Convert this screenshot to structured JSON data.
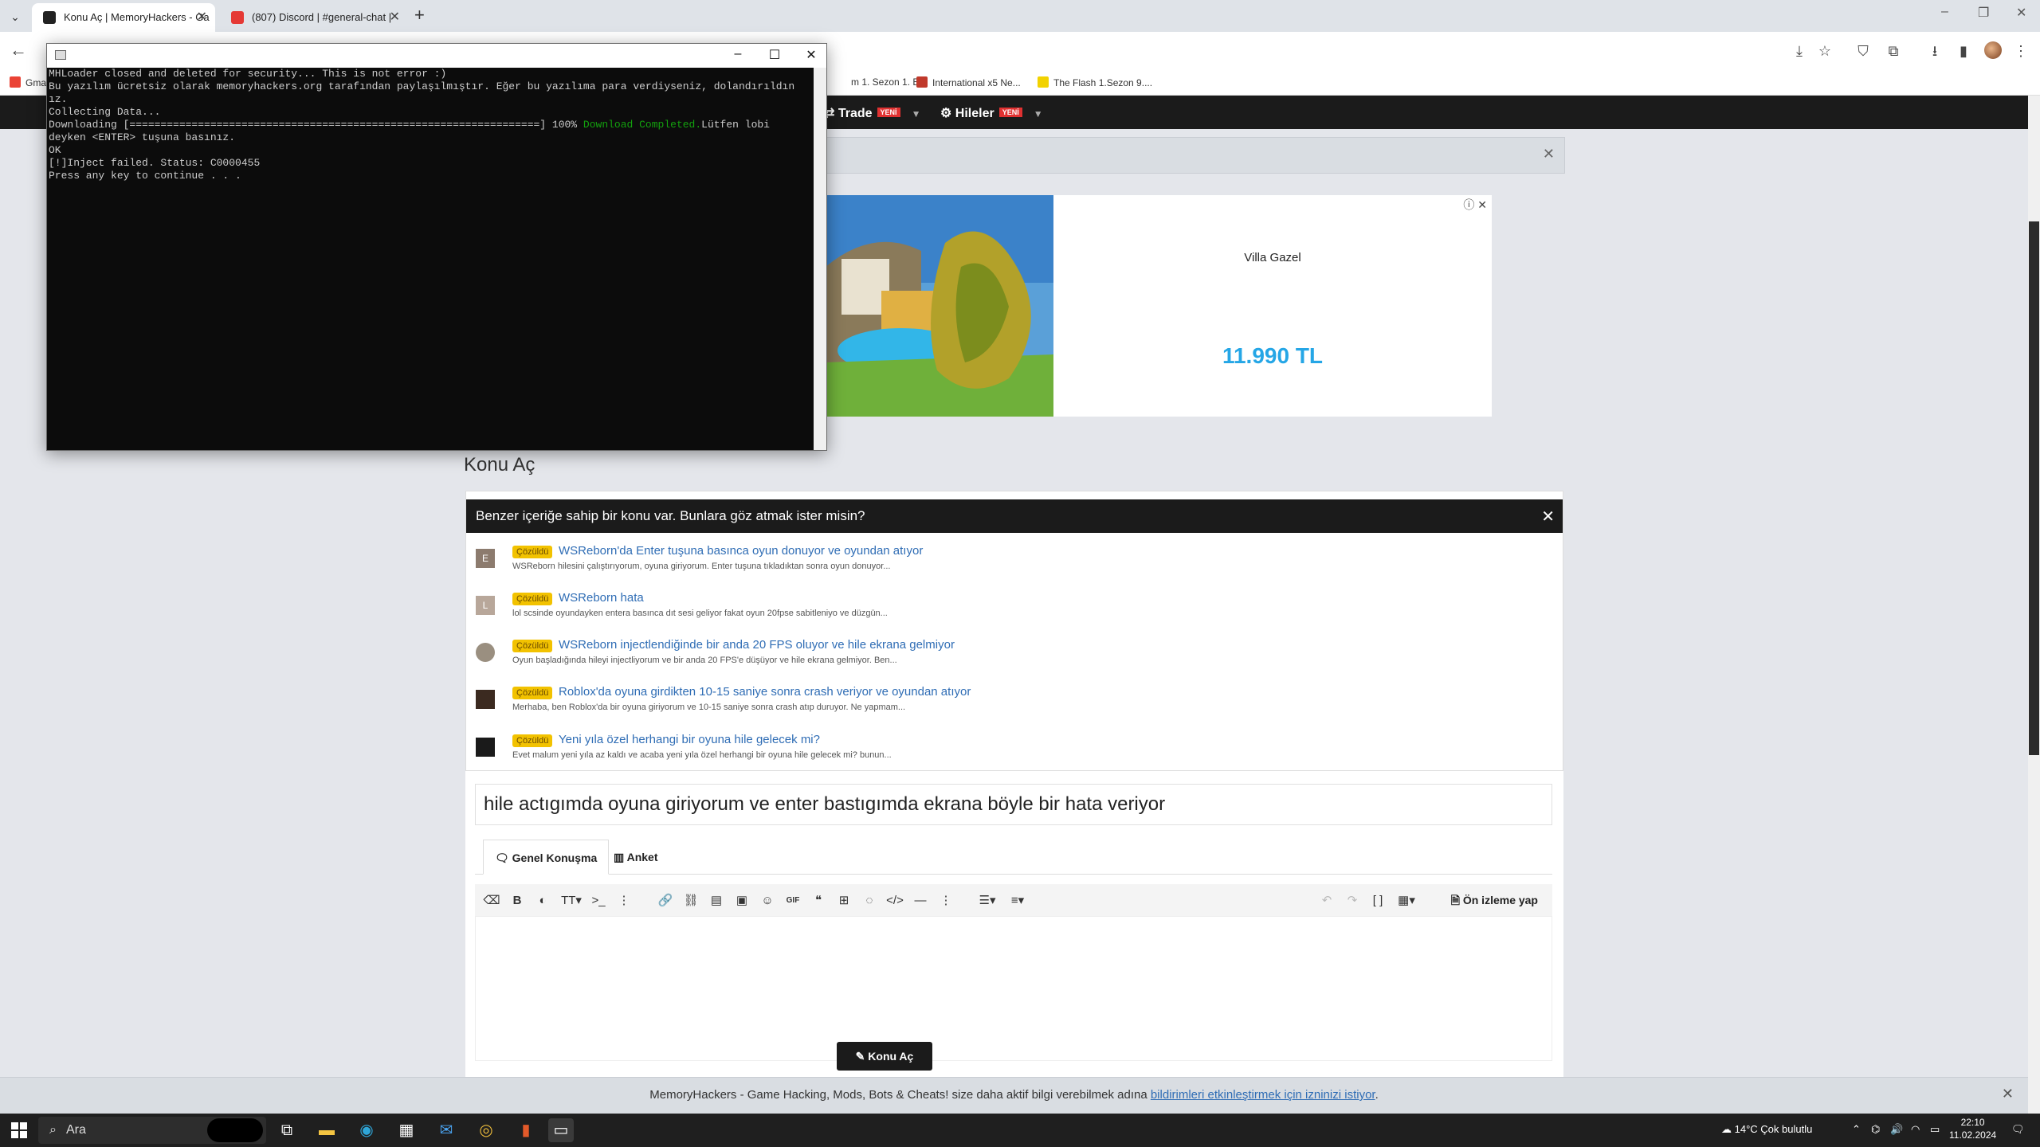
{
  "browser": {
    "tabs": [
      {
        "title": "Konu Aç | MemoryHackers - Ga",
        "active": true
      },
      {
        "title": "(807) Discord | #general-chat |",
        "active": false
      }
    ],
    "bookmarks": [
      {
        "label": "Gmai"
      },
      {
        "label": "m 1. Sezon 1. B..."
      },
      {
        "label": "International x5 Ne..."
      },
      {
        "label": "The Flash 1.Sezon 9...."
      }
    ]
  },
  "site": {
    "nav": [
      {
        "label": "Trade",
        "badge": "YENİ"
      },
      {
        "label": "Hileler",
        "badge": "YENİ"
      }
    ],
    "ad": {
      "title": "Villa Gazel",
      "price": "11.990 TL"
    },
    "page_title": "Konu Aç",
    "similar": {
      "header": "Benzer içeriğe sahip bir konu var. Bunlara göz atmak ister misin?",
      "items": [
        {
          "avatar": "E",
          "badge": "Çözüldü",
          "title": "WSReborn'da Enter tuşuna basınca oyun donuyor ve oyundan atıyor",
          "snippet": "WSReborn hilesini çalıştırıyorum, oyuna giriyorum. Enter tuşuna tıkladıktan sonra oyun donuyor..."
        },
        {
          "avatar": "L",
          "badge": "Çözüldü",
          "title": "WSReborn hata",
          "snippet": "lol scsinde oyundayken entera basınca dıt sesi geliyor fakat oyun 20fpse sabitleniyo ve düzgün..."
        },
        {
          "avatar": "",
          "badge": "Çözüldü",
          "title": "WSReborn injectlendiğinde bir anda 20 FPS oluyor ve hile ekrana gelmiyor",
          "snippet": "Oyun başladığında hileyi injectliyorum ve bir anda 20 FPS'e düşüyor ve hile ekrana gelmiyor. Ben..."
        },
        {
          "avatar": "",
          "badge": "Çözüldü",
          "title": "Roblox'da oyuna girdikten 10-15 saniye sonra crash veriyor ve oyundan atıyor",
          "snippet": "Merhaba, ben Roblox'da bir oyuna giriyorum ve 10-15 saniye sonra crash atıp duruyor. Ne yapmam..."
        },
        {
          "avatar": "",
          "badge": "Çözüldü",
          "title": "Yeni yıla özel herhangi bir oyuna hile gelecek mi?",
          "snippet": "Evet malum yeni yıla az kaldı ve acaba yeni yıla özel herhangi bir oyuna hile gelecek mi? bunun..."
        }
      ]
    },
    "compose": {
      "title_value": "hile actıgımda oyuna giriyorum ve enter bastıgımda ekrana böyle bir hata veriyor",
      "tab_discussion": "Genel Konuşma",
      "tab_poll": "Anket",
      "preview": "Ön izleme yap",
      "submit": "Konu Aç"
    },
    "push_notice": {
      "text": "MemoryHackers - Game Hacking, Mods, Bots & Cheats! size daha aktif bilgi verebilmek adına ",
      "link": "bildirimleri etkinleştirmek için izninizi istiyor",
      "end": "."
    }
  },
  "console": {
    "line1": "MHLoader closed and deleted for security... This is not error :)",
    "line2": "Bu yazılım ücretsiz olarak memoryhackers.org tarafından paylaşılmıştır. Eğer bu yazılıma para verdiyseniz, dolandırıldın",
    "line3": "ız.",
    "line4": "Collecting Data...",
    "line5_a": "Downloading [==================================================================] 100% ",
    "line5_b": "Download Completed.",
    "line5_c": "Lütfen lobi",
    "line6": "deyken <ENTER> tuşuna basınız.",
    "line7": "OK",
    "line8": "[!]Inject failed. Status: C0000455",
    "line9": "Press any key to continue . . ."
  },
  "taskbar": {
    "search": "Ara",
    "weather": "14°C  Çok bulutlu",
    "time": "22:10",
    "date": "11.02.2024"
  },
  "colors": {
    "accent_blue": "#25a6e6",
    "solved_badge": "#f2c200",
    "nav_dark": "#1b1b1b",
    "new_badge": "#e03131"
  }
}
